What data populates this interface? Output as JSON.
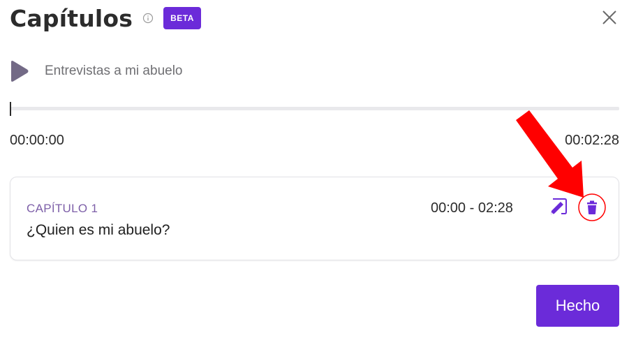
{
  "header": {
    "title": "Capítulos",
    "info_icon": "info-circle-icon",
    "badge": "BETA",
    "close_icon": "close-icon"
  },
  "player": {
    "play_icon": "play-icon",
    "episode_title": "Entrevistas a mi abuelo",
    "progress": 0,
    "time_start": "00:00:00",
    "time_end": "00:02:28"
  },
  "chapters": [
    {
      "label": "CAPÍTULO 1",
      "title": "¿Quien es mi abuelo?",
      "range": "00:00 - 02:28",
      "edit_icon": "edit-pencil-icon",
      "delete_icon": "trash-icon"
    }
  ],
  "footer": {
    "done_label": "Hecho"
  },
  "colors": {
    "accent": "#6b2bd9",
    "annotation": "#ff0000",
    "chapter_label": "#7d5fa8",
    "muted_text": "#6f6f73"
  }
}
